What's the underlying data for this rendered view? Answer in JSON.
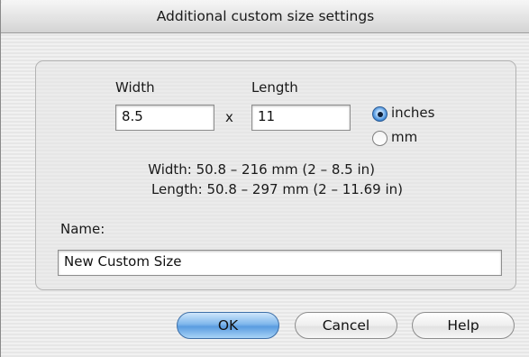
{
  "window": {
    "title": "Additional custom size settings"
  },
  "size": {
    "width_label": "Width",
    "length_label": "Length",
    "width_value": "8.5",
    "times_symbol": "x",
    "length_value": "11",
    "units": {
      "options": [
        "inches",
        "mm"
      ],
      "selected": "inches"
    },
    "width_range": "Width: 50.8 – 216 mm (2 – 8.5 in)",
    "length_range": "Length: 50.8 – 297 mm (2 – 11.69 in)"
  },
  "name": {
    "label": "Name:",
    "value": "New Custom Size"
  },
  "buttons": {
    "ok": "OK",
    "cancel": "Cancel",
    "help": "Help"
  },
  "colors": {
    "default_button": "#5a9ce0",
    "radio_selected": "#3b86d6"
  }
}
